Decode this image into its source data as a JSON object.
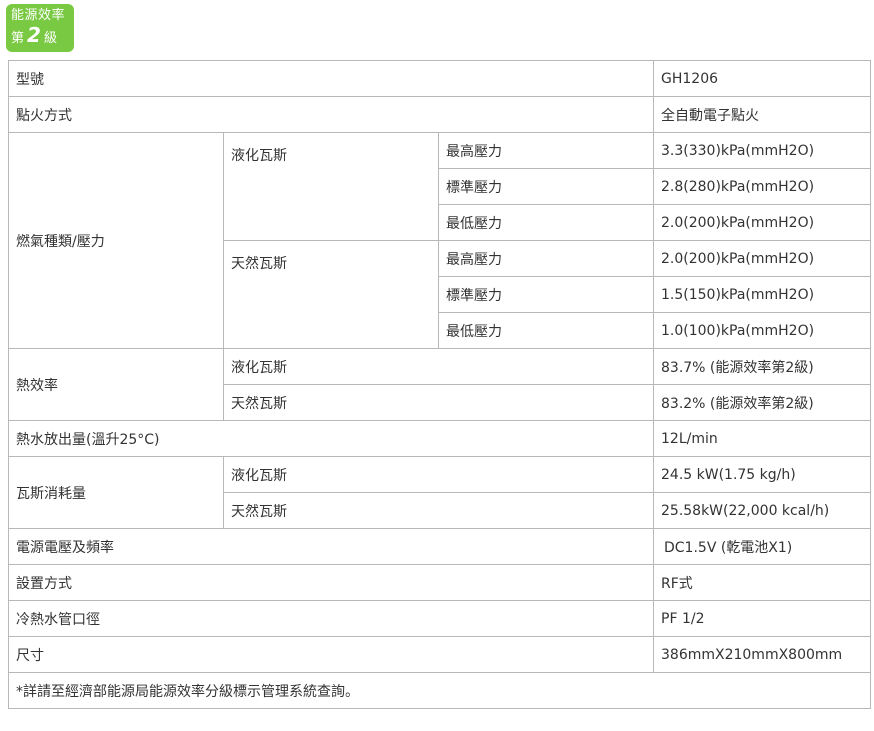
{
  "badge": {
    "line1": "能源效率",
    "prefix": "第",
    "grade": "2",
    "suffix": "級"
  },
  "spec": {
    "model_label": "型號",
    "model_value": "GH1206",
    "ignition_label": "點火方式",
    "ignition_value": "全自動電子點火",
    "gas_label": "燃氣種類/壓力",
    "lpg_label": "液化瓦斯",
    "ng_label": "天然瓦斯",
    "pressure_high": "最高壓力",
    "pressure_std": "標準壓力",
    "pressure_low": "最低壓力",
    "lpg_high": "3.3(330)kPa(mmH2O)",
    "lpg_std": "2.8(280)kPa(mmH2O)",
    "lpg_low": "2.0(200)kPa(mmH2O)",
    "ng_high": "2.0(200)kPa(mmH2O)",
    "ng_std": "1.5(150)kPa(mmH2O)",
    "ng_low": "1.0(100)kPa(mmH2O)",
    "efficiency_label": "熱效率",
    "lpg_eff": "83.7% (能源效率第2級)",
    "ng_eff": "83.2% (能源效率第2級)",
    "hotwater_label": "熱水放出量(溫升25°C)",
    "hotwater_value": "12L/min",
    "consumption_label": "瓦斯消耗量",
    "lpg_consumption": "24.5 kW(1.75 kg/h)",
    "ng_consumption": "25.58kW(22,000 kcal/h)",
    "power_label": "電源電壓及頻率",
    "power_value": "DC1.5V (乾電池X1)",
    "install_label": "設置方式",
    "install_value": "RF式",
    "pipe_label": "冷熱水管口徑",
    "pipe_value": "PF 1/2",
    "size_label": "尺寸",
    "size_value": "386mmX210mmX800mm",
    "note": "*詳請至經濟部能源局能源效率分級標示管理系統查詢。"
  },
  "colors": {
    "badge_bg": "#7ac943",
    "border": "#b8b8b8",
    "text": "#333333"
  }
}
